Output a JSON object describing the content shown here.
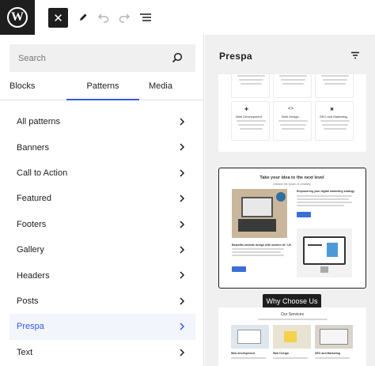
{
  "toolbar": {
    "logo": "W",
    "close_glyph": "✕",
    "icons": [
      "wordpress-logo",
      "close-icon",
      "pencil-icon",
      "undo-icon",
      "redo-icon",
      "list-view-icon"
    ]
  },
  "inserter": {
    "search": {
      "placeholder": "Search",
      "value": ""
    },
    "tabs": [
      {
        "label": "Blocks",
        "active": false
      },
      {
        "label": "Patterns",
        "active": true
      },
      {
        "label": "Media",
        "active": false
      }
    ],
    "categories": [
      {
        "label": "All patterns",
        "active": false
      },
      {
        "label": "Banners",
        "active": false
      },
      {
        "label": "Call to Action",
        "active": false
      },
      {
        "label": "Featured",
        "active": false
      },
      {
        "label": "Footers",
        "active": false
      },
      {
        "label": "Gallery",
        "active": false
      },
      {
        "label": "Headers",
        "active": false
      },
      {
        "label": "Posts",
        "active": false
      },
      {
        "label": "Prespa",
        "active": true
      },
      {
        "label": "Text",
        "active": false
      }
    ]
  },
  "preview": {
    "title": "Prespa",
    "card2": {
      "heading": "Take your idea to the next level",
      "subheading": "Unleash the power of creativity",
      "text_a": "Empowering your digital marketing strategy",
      "text_b": "Beautiful website design with modern UI / UX"
    },
    "tooltip": "Why Choose Us",
    "card3": {
      "heading": "Our Services",
      "items": [
        "Web development",
        "Web Design",
        "SEO and Marketing"
      ]
    },
    "card1": {
      "items": [
        "Web Development",
        "Web Design",
        "SEO and Marketing"
      ]
    }
  },
  "colors": {
    "accent": "#3858e9",
    "dark": "#1e1e1e",
    "panel_bg": "#f0f0f0",
    "active_row_bg": "#f2f5fb"
  }
}
